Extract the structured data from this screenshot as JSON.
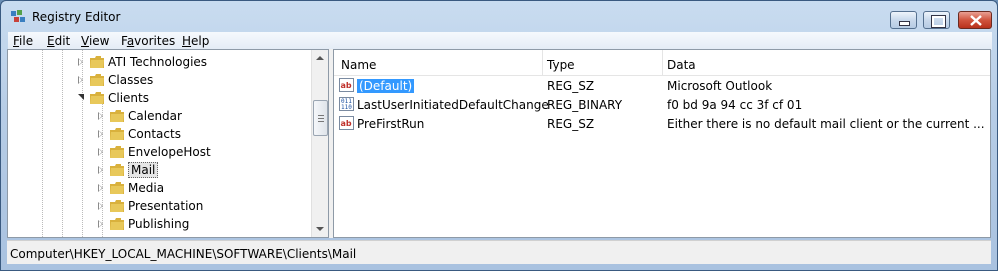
{
  "window": {
    "title": "Registry Editor"
  },
  "menu": {
    "items": [
      "File",
      "Edit",
      "View",
      "Favorites",
      "Help"
    ],
    "accelerators": [
      "F",
      "E",
      "V",
      "a",
      "H"
    ]
  },
  "tree": {
    "items": [
      {
        "label": "ATI Technologies",
        "level": 1,
        "expanded": false
      },
      {
        "label": "Classes",
        "level": 1,
        "expanded": false
      },
      {
        "label": "Clients",
        "level": 1,
        "expanded": true
      },
      {
        "label": "Calendar",
        "level": 2,
        "expanded": false
      },
      {
        "label": "Contacts",
        "level": 2,
        "expanded": false
      },
      {
        "label": "EnvelopeHost",
        "level": 2,
        "expanded": false
      },
      {
        "label": "Mail",
        "level": 2,
        "expanded": false,
        "selected": true
      },
      {
        "label": "Media",
        "level": 2,
        "expanded": false
      },
      {
        "label": "Presentation",
        "level": 2,
        "expanded": false
      },
      {
        "label": "Publishing",
        "level": 2,
        "expanded": false
      }
    ]
  },
  "list": {
    "columns": [
      "Name",
      "Type",
      "Data"
    ],
    "rows": [
      {
        "icon": "string-value-icon",
        "name": "(Default)",
        "type": "REG_SZ",
        "data": "Microsoft Outlook",
        "selected": true
      },
      {
        "icon": "binary-value-icon",
        "name": "LastUserInitiatedDefaultChange",
        "type": "REG_BINARY",
        "data": "f0 bd 9a 94 cc 3f cf 01"
      },
      {
        "icon": "string-value-icon",
        "name": "PreFirstRun",
        "type": "REG_SZ",
        "data": "Either there is no default mail client or the current ..."
      }
    ]
  },
  "status": {
    "path": "Computer\\HKEY_LOCAL_MACHINE\\SOFTWARE\\Clients\\Mail"
  },
  "colors": {
    "selection": "#3399ff",
    "folder": "#e8c85a"
  }
}
